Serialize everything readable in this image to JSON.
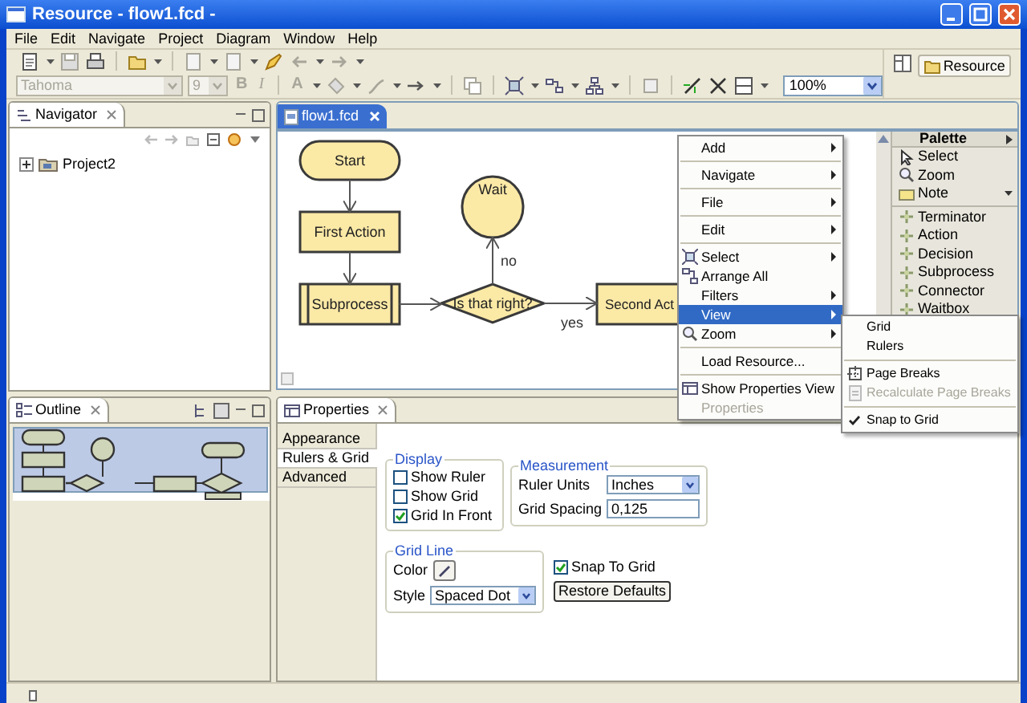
{
  "window": {
    "title": "Resource - flow1.fcd -"
  },
  "menu_bar": [
    "File",
    "Edit",
    "Navigate",
    "Project",
    "Diagram",
    "Window",
    "Help"
  ],
  "toolbar": {
    "font": {
      "value": "Tahoma",
      "disabled": true
    },
    "font_size": {
      "value": "9",
      "disabled": true
    },
    "text_buttons": [
      {
        "label": "B",
        "disabled": true
      },
      {
        "label": "I",
        "disabled": true
      },
      {
        "label": "A",
        "disabled": true
      }
    ],
    "zoom": {
      "value": "100%"
    },
    "perspective": "Resource"
  },
  "navigator": {
    "title": "Navigator",
    "tree": [
      {
        "label": "Project2",
        "expanded": false
      }
    ]
  },
  "outline": {
    "title": "Outline"
  },
  "editor": {
    "tabs": [
      {
        "label": "flow1.fcd",
        "selected": true
      }
    ],
    "diagram": {
      "nodes": [
        {
          "kind": "terminator",
          "label": "Start"
        },
        {
          "kind": "waitbox",
          "label": "Wait"
        },
        {
          "kind": "action",
          "label": "First Action"
        },
        {
          "kind": "subprocess",
          "label": "Subprocess"
        },
        {
          "kind": "decision",
          "label": "Is that right?"
        },
        {
          "kind": "action",
          "label": "Second Act"
        }
      ],
      "connector_labels": [
        "no",
        "yes"
      ]
    }
  },
  "palette": {
    "title": "Palette",
    "groups": [
      [
        {
          "label": "Select",
          "dropdown": false
        },
        {
          "label": "Zoom",
          "dropdown": false
        },
        {
          "label": "Note",
          "dropdown": true
        }
      ],
      [
        {
          "label": "Terminator",
          "dropdown": false
        },
        {
          "label": "Action",
          "dropdown": false
        },
        {
          "label": "Decision",
          "dropdown": false
        },
        {
          "label": "Subprocess",
          "dropdown": false
        },
        {
          "label": "Connector",
          "dropdown": false
        },
        {
          "label": "Waitbox",
          "dropdown": false
        }
      ]
    ]
  },
  "context_menu": {
    "groups": [
      [
        {
          "label": "Add",
          "submenu": true,
          "selected": false,
          "disabled": false
        }
      ],
      [
        {
          "label": "Navigate",
          "submenu": true,
          "selected": false,
          "disabled": false
        }
      ],
      [
        {
          "label": "File",
          "submenu": true,
          "selected": false,
          "disabled": false
        }
      ],
      [
        {
          "label": "Edit",
          "submenu": true,
          "selected": false,
          "disabled": false
        }
      ],
      [
        {
          "label": "Select",
          "submenu": true,
          "selected": false,
          "disabled": false
        },
        {
          "label": "Arrange All",
          "submenu": false,
          "selected": false,
          "disabled": false
        },
        {
          "label": "Filters",
          "submenu": true,
          "selected": false,
          "disabled": false
        },
        {
          "label": "View",
          "submenu": true,
          "selected": true,
          "disabled": false
        },
        {
          "label": "Zoom",
          "submenu": true,
          "selected": false,
          "disabled": false
        }
      ],
      [
        {
          "label": "Load Resource...",
          "submenu": false,
          "selected": false,
          "disabled": false
        }
      ],
      [
        {
          "label": "Show Properties View",
          "submenu": false,
          "selected": false,
          "disabled": false
        },
        {
          "label": "Properties",
          "submenu": false,
          "selected": false,
          "disabled": true
        }
      ]
    ]
  },
  "submenu": {
    "groups": [
      [
        {
          "label": "Grid",
          "checked": false,
          "disabled": false
        },
        {
          "label": "Rulers",
          "checked": false,
          "disabled": false
        }
      ],
      [
        {
          "label": "Page Breaks",
          "checked": false,
          "disabled": false
        },
        {
          "label": "Recalculate Page Breaks",
          "checked": false,
          "disabled": true
        }
      ],
      [
        {
          "label": "Snap to Grid",
          "checked": true,
          "disabled": false
        }
      ]
    ]
  },
  "properties": {
    "title": "Properties",
    "tabs": [
      {
        "label": "Appearance",
        "selected": false
      },
      {
        "label": "Rulers & Grid",
        "selected": true
      },
      {
        "label": "Advanced",
        "selected": false
      }
    ],
    "display": {
      "title": "Display",
      "checkboxes": [
        {
          "label": "Show Ruler",
          "checked": false
        },
        {
          "label": "Show Grid",
          "checked": false
        },
        {
          "label": "Grid In Front",
          "checked": true
        }
      ]
    },
    "measurement": {
      "title": "Measurement",
      "ruler_units": {
        "label": "Ruler Units",
        "value": "Inches"
      },
      "grid_spacing": {
        "label": "Grid Spacing",
        "value": "0,125"
      }
    },
    "grid_line": {
      "title": "Grid Line",
      "color_label": "Color",
      "style": {
        "label": "Style",
        "value": "Spaced Dot"
      }
    },
    "snap_to_grid": {
      "label": "Snap To Grid",
      "checked": true
    },
    "restore_defaults": "Restore Defaults"
  }
}
